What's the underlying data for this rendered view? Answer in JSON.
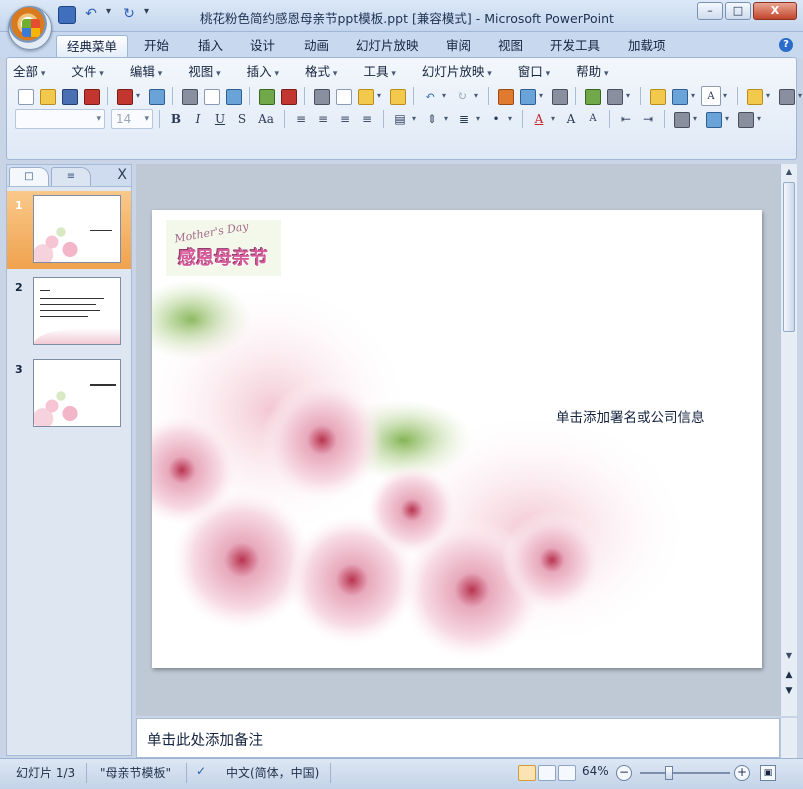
{
  "window": {
    "title": "桃花粉色简约感恩母亲节ppt模板.ppt [兼容模式] - Microsoft PowerPoint",
    "controls": {
      "minimize": "–",
      "maximize": "□",
      "close": "X"
    }
  },
  "ribbon_tabs": [
    "经典菜单",
    "开始",
    "插入",
    "设计",
    "动画",
    "幻灯片放映",
    "审阅",
    "视图",
    "开发工具",
    "加载项"
  ],
  "classic_menu": [
    "全部",
    "文件",
    "编辑",
    "视图",
    "插入",
    "格式",
    "工具",
    "幻灯片放映",
    "窗口",
    "帮助"
  ],
  "format_toolbar": {
    "font_name": "",
    "font_size": "14",
    "bold": "B",
    "italic": "I",
    "underline": "U",
    "shadow": "S",
    "char_spacing": "Aa"
  },
  "left_pane": {
    "tabs": [
      "slides-tab",
      "outline-tab"
    ],
    "close": "X",
    "thumbnails": [
      {
        "number": "1",
        "selected": true
      },
      {
        "number": "2",
        "selected": false
      },
      {
        "number": "3",
        "selected": false
      }
    ]
  },
  "slide": {
    "logo_english": "Mother's Day",
    "logo_chinese": "感恩母亲节",
    "subtitle_placeholder": "单击添加署名或公司信息"
  },
  "notes_placeholder": "单击此处添加备注",
  "status_bar": {
    "slide_indicator": "幻灯片 1/3",
    "theme": "\"母亲节模板\"",
    "language": "中文(简体，中国)",
    "zoom": "64%",
    "zoom_fraction": 0.64
  },
  "colors": {
    "selected_thumb": "#f0a24e",
    "window_chrome": "#c7d8ef",
    "logo_pink": "#d45a98"
  }
}
